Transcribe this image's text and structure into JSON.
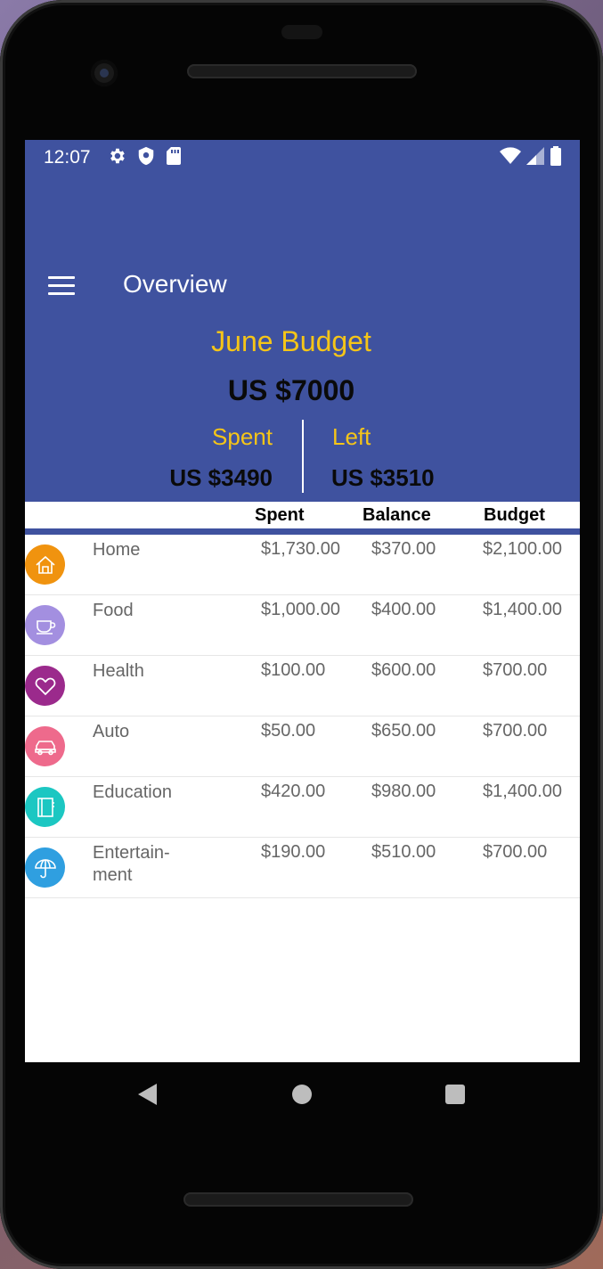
{
  "status_bar": {
    "time": "12:07",
    "left_icons": [
      "gear-icon",
      "shield-icon",
      "sd-card-icon"
    ],
    "right_icons": [
      "wifi-icon",
      "signal-icon",
      "battery-icon"
    ]
  },
  "app_bar": {
    "title": "Overview",
    "menu_icon": "hamburger-menu-icon",
    "color": "#3f529f"
  },
  "summary": {
    "budget_title": "June Budget",
    "budget_total": "US $7000",
    "spent_label": "Spent",
    "spent_value": "US $3490",
    "left_label": "Left",
    "left_value": "US $3510",
    "accent": "#f5c518"
  },
  "table": {
    "columns": [
      "Spent",
      "Balance",
      "Budget"
    ],
    "rows": [
      {
        "category": "Home",
        "icon": "home-icon",
        "icon_color": "#f0930f",
        "spent": "$1,730.00",
        "balance": "$370.00",
        "budget": "$2,100.00"
      },
      {
        "category": "Food",
        "icon": "coffee-cup-icon",
        "icon_color": "#a38fe0",
        "spent": "$1,000.00",
        "balance": "$400.00",
        "budget": "$1,400.00"
      },
      {
        "category": "Health",
        "icon": "heart-icon",
        "icon_color": "#9b2a8c",
        "spent": "$100.00",
        "balance": "$600.00",
        "budget": "$700.00"
      },
      {
        "category": "Auto",
        "icon": "car-icon",
        "icon_color": "#ee6a8c",
        "spent": "$50.00",
        "balance": "$650.00",
        "budget": "$700.00"
      },
      {
        "category": "Education",
        "icon": "book-icon",
        "icon_color": "#1cc7c2",
        "spent": "$420.00",
        "balance": "$980.00",
        "budget": "$1,400.00"
      },
      {
        "category": "Entertain-\nment",
        "icon": "umbrella-icon",
        "icon_color": "#2f9fe0",
        "spent": "$190.00",
        "balance": "$510.00",
        "budget": "$700.00"
      }
    ]
  },
  "nav_bar": {
    "buttons": [
      "back-icon",
      "home-circle-icon",
      "recents-square-icon"
    ]
  }
}
